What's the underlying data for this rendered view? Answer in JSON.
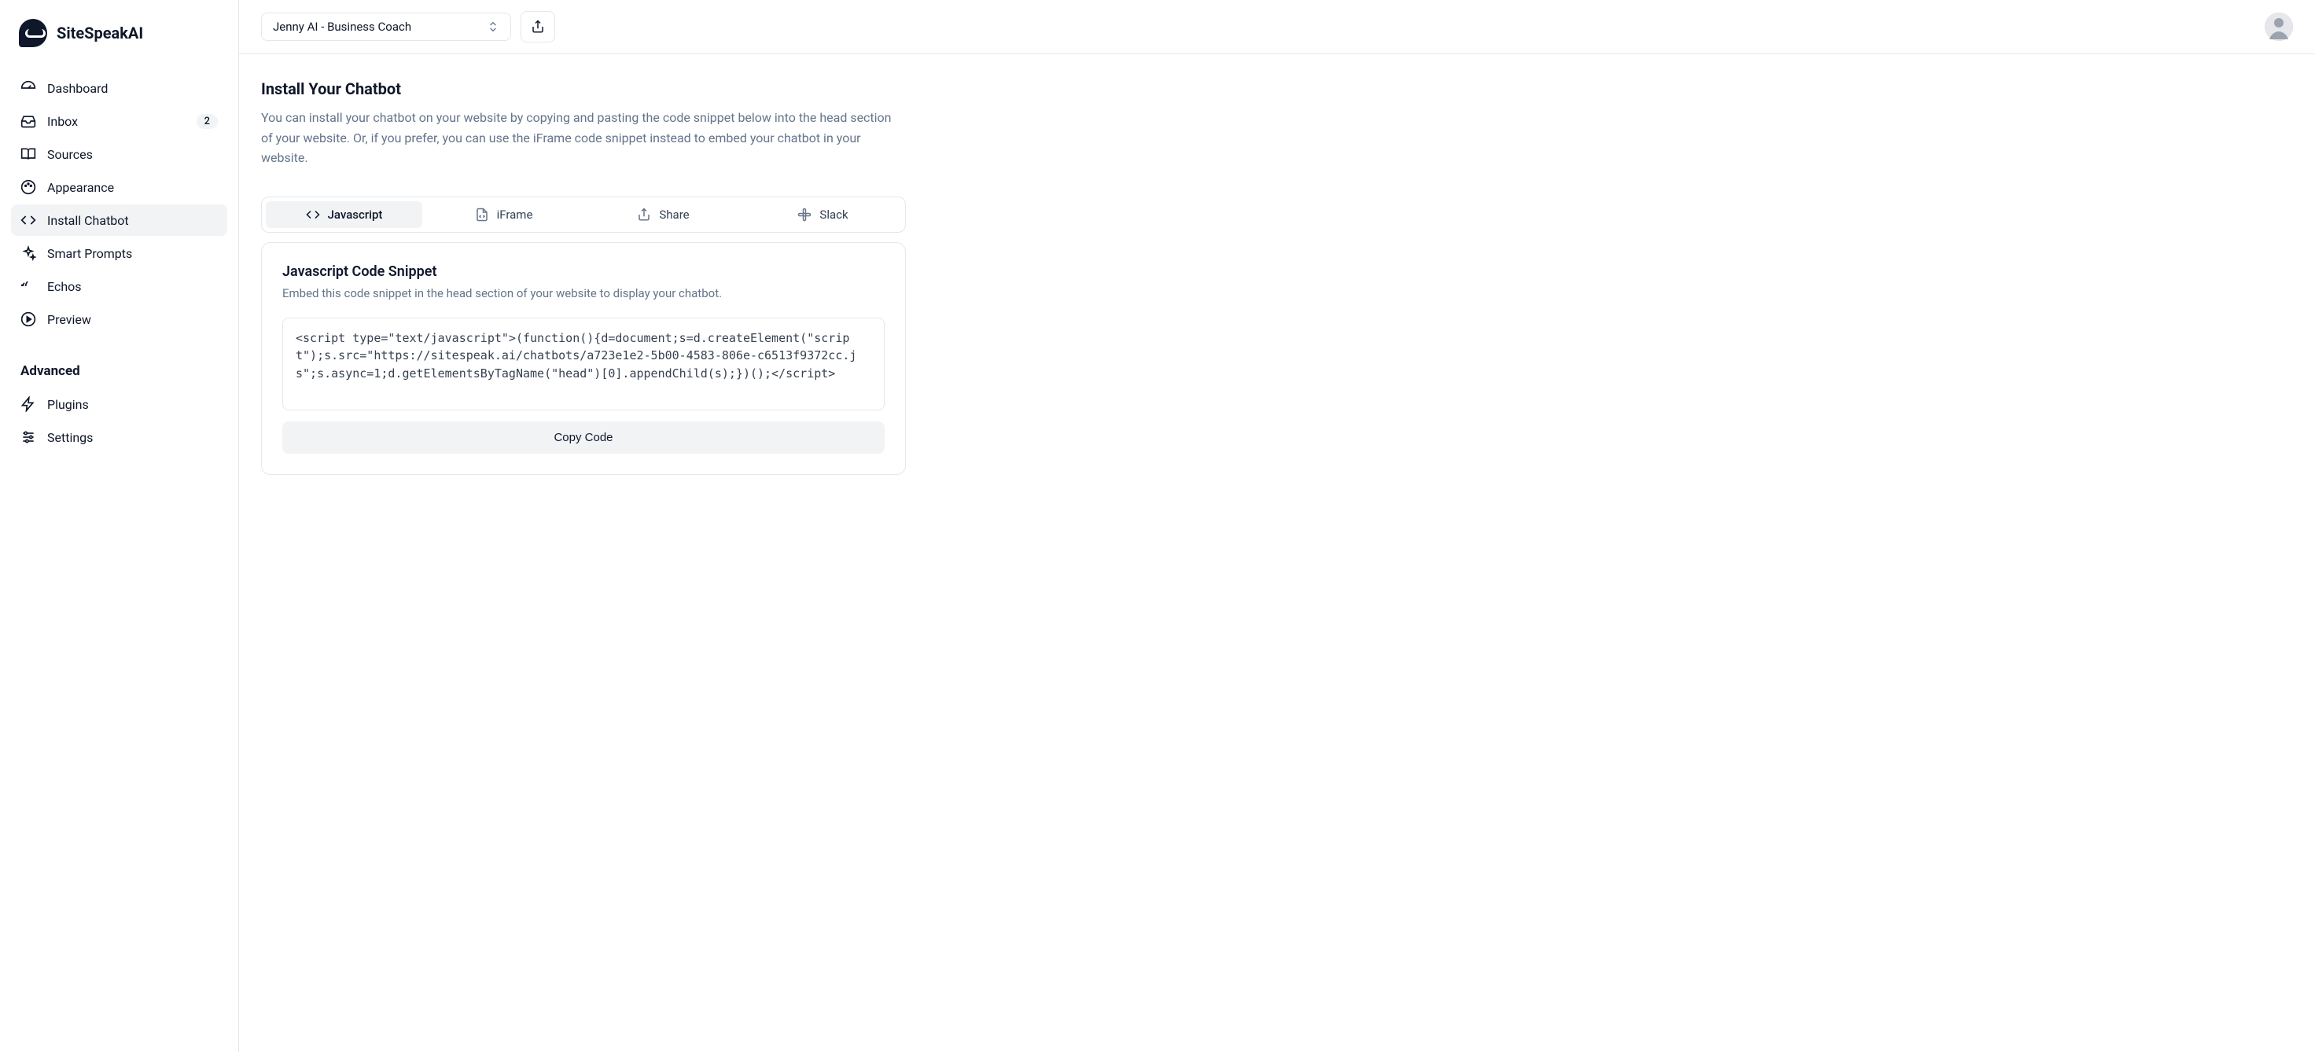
{
  "brand": {
    "name": "SiteSpeakAI"
  },
  "sidebar": {
    "items": [
      {
        "label": "Dashboard"
      },
      {
        "label": "Inbox",
        "badge": "2"
      },
      {
        "label": "Sources"
      },
      {
        "label": "Appearance"
      },
      {
        "label": "Install Chatbot"
      },
      {
        "label": "Smart Prompts"
      },
      {
        "label": "Echos"
      },
      {
        "label": "Preview"
      }
    ],
    "advanced_heading": "Advanced",
    "advanced": [
      {
        "label": "Plugins"
      },
      {
        "label": "Settings"
      }
    ]
  },
  "topbar": {
    "selector_label": "Jenny AI - Business Coach"
  },
  "page": {
    "title": "Install Your Chatbot",
    "description": "You can install your chatbot on your website by copying and pasting the code snippet below into the head section of your website. Or, if you prefer, you can use the iFrame code snippet instead to embed your chatbot in your website."
  },
  "tabs": [
    {
      "label": "Javascript"
    },
    {
      "label": "iFrame"
    },
    {
      "label": "Share"
    },
    {
      "label": "Slack"
    }
  ],
  "panel": {
    "title": "Javascript Code Snippet",
    "description": "Embed this code snippet in the head section of your website to display your chatbot.",
    "code": "<script type=\"text/javascript\">(function(){d=document;s=d.createElement(\"script\");s.src=\"https://sitespeak.ai/chatbots/a723e1e2-5b00-4583-806e-c6513f9372cc.js\";s.async=1;d.getElementsByTagName(\"head\")[0].appendChild(s);})();</​script>",
    "copy_label": "Copy Code"
  }
}
